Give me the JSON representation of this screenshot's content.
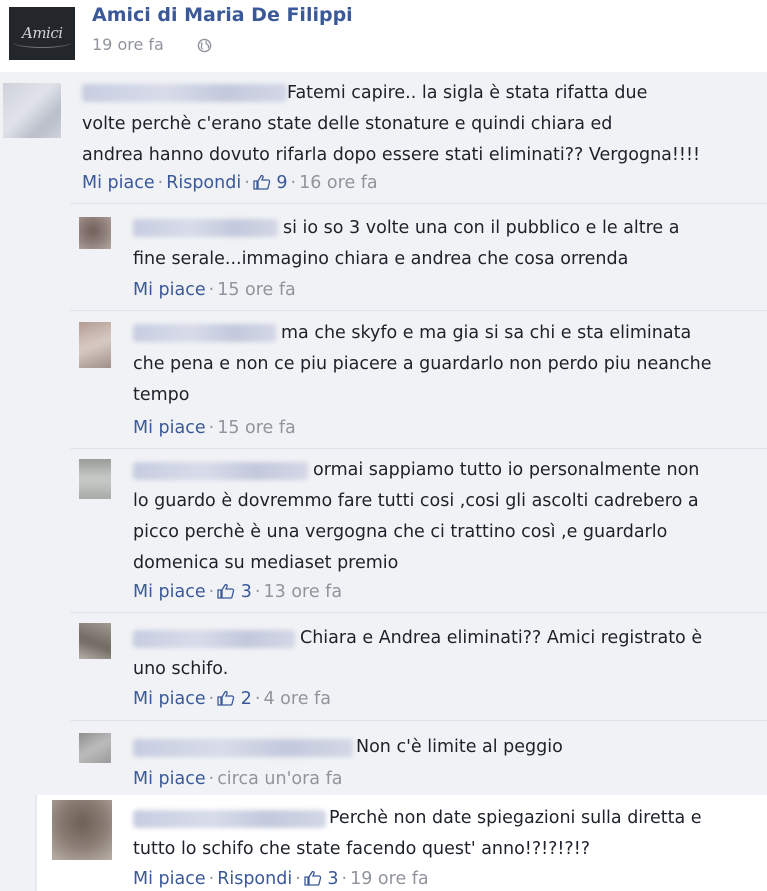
{
  "page": {
    "name": "Amici di Maria De Filippi",
    "time": "19 ore fa",
    "logo_text": "Amici"
  },
  "labels": {
    "like": "Mi piace",
    "reply": "Rispondi"
  },
  "comments": [
    {
      "lines": [
        "Fatemi capire.. la sigla è stata rifatta due",
        "volte perchè c'erano state delle stonature e quindi chiara ed",
        "andrea hanno dovuto rifarla dopo essere stati eliminati?? Vergogna!!!!"
      ],
      "likes": "9",
      "time": "16 ore fa",
      "reply": true
    },
    {
      "lines": [
        "si io so 3 volte una con il pubblico e le altre a",
        "fine serale...immagino chiara e andrea che cosa orrenda"
      ],
      "likes": "",
      "time": "15 ore fa",
      "reply": false
    },
    {
      "lines": [
        "ma che skyfo e ma gia si sa chi e sta eliminata",
        "che pena e non ce piu piacere a guardarlo non perdo piu neanche",
        "tempo"
      ],
      "likes": "",
      "time": "15 ore fa",
      "reply": false
    },
    {
      "lines": [
        "ormai sappiamo tutto io personalmente non",
        "lo guardo è dovremmo fare tutti cosi ,cosi gli ascolti cadrebero a",
        "picco perchè è una vergogna che ci trattino così ,e guardarlo",
        "domenica su mediaset premio"
      ],
      "likes": "3",
      "time": "13 ore fa",
      "reply": false
    },
    {
      "lines": [
        "Chiara e Andrea eliminati?? Amici registrato è",
        "uno schifo."
      ],
      "likes": "2",
      "time": "4 ore fa",
      "reply": false
    },
    {
      "lines": [
        "Non c'è limite al peggio"
      ],
      "likes": "",
      "time": "circa un'ora fa",
      "reply": false
    },
    {
      "lines": [
        "Perchè non date spiegazioni sulla diretta e",
        "tutto lo schifo che state facendo quest' anno!?!?!?!?"
      ],
      "likes": "3",
      "time": "19 ore fa",
      "reply": true
    }
  ],
  "colors": {
    "link": "#3b5998",
    "meta": "#90949c",
    "text": "#1d2129",
    "background": "#f0f2f5"
  },
  "icons": {
    "like": "thumbs-up-icon",
    "privacy": "globe-icon"
  }
}
